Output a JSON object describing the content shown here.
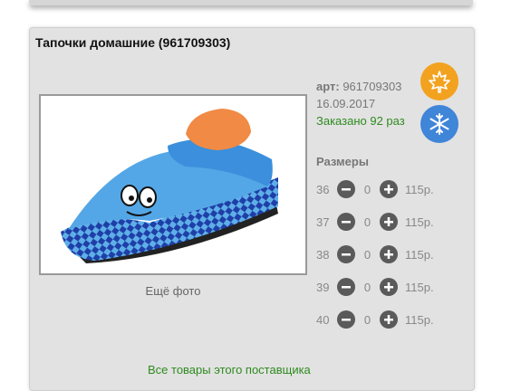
{
  "product": {
    "title": "Тапочки домашние (961709303)",
    "art_label": "арт:",
    "art_value": "961709303",
    "date": "16.09.2017",
    "ordered": "Заказано 92 раз",
    "more_photo": "Ещё фото"
  },
  "badges": [
    {
      "icon": "maple-leaf-icon",
      "color": "#f2a21f"
    },
    {
      "icon": "snowflake-icon",
      "color": "#3f85d8"
    }
  ],
  "sizes": {
    "title": "Размеры",
    "rows": [
      {
        "size": "36",
        "qty": "0",
        "price": "115р."
      },
      {
        "size": "37",
        "qty": "0",
        "price": "115р."
      },
      {
        "size": "38",
        "qty": "0",
        "price": "115р."
      },
      {
        "size": "39",
        "qty": "0",
        "price": "115р."
      },
      {
        "size": "40",
        "qty": "0",
        "price": "115р."
      }
    ]
  },
  "bottom_link": "Все товары этого поставщика"
}
